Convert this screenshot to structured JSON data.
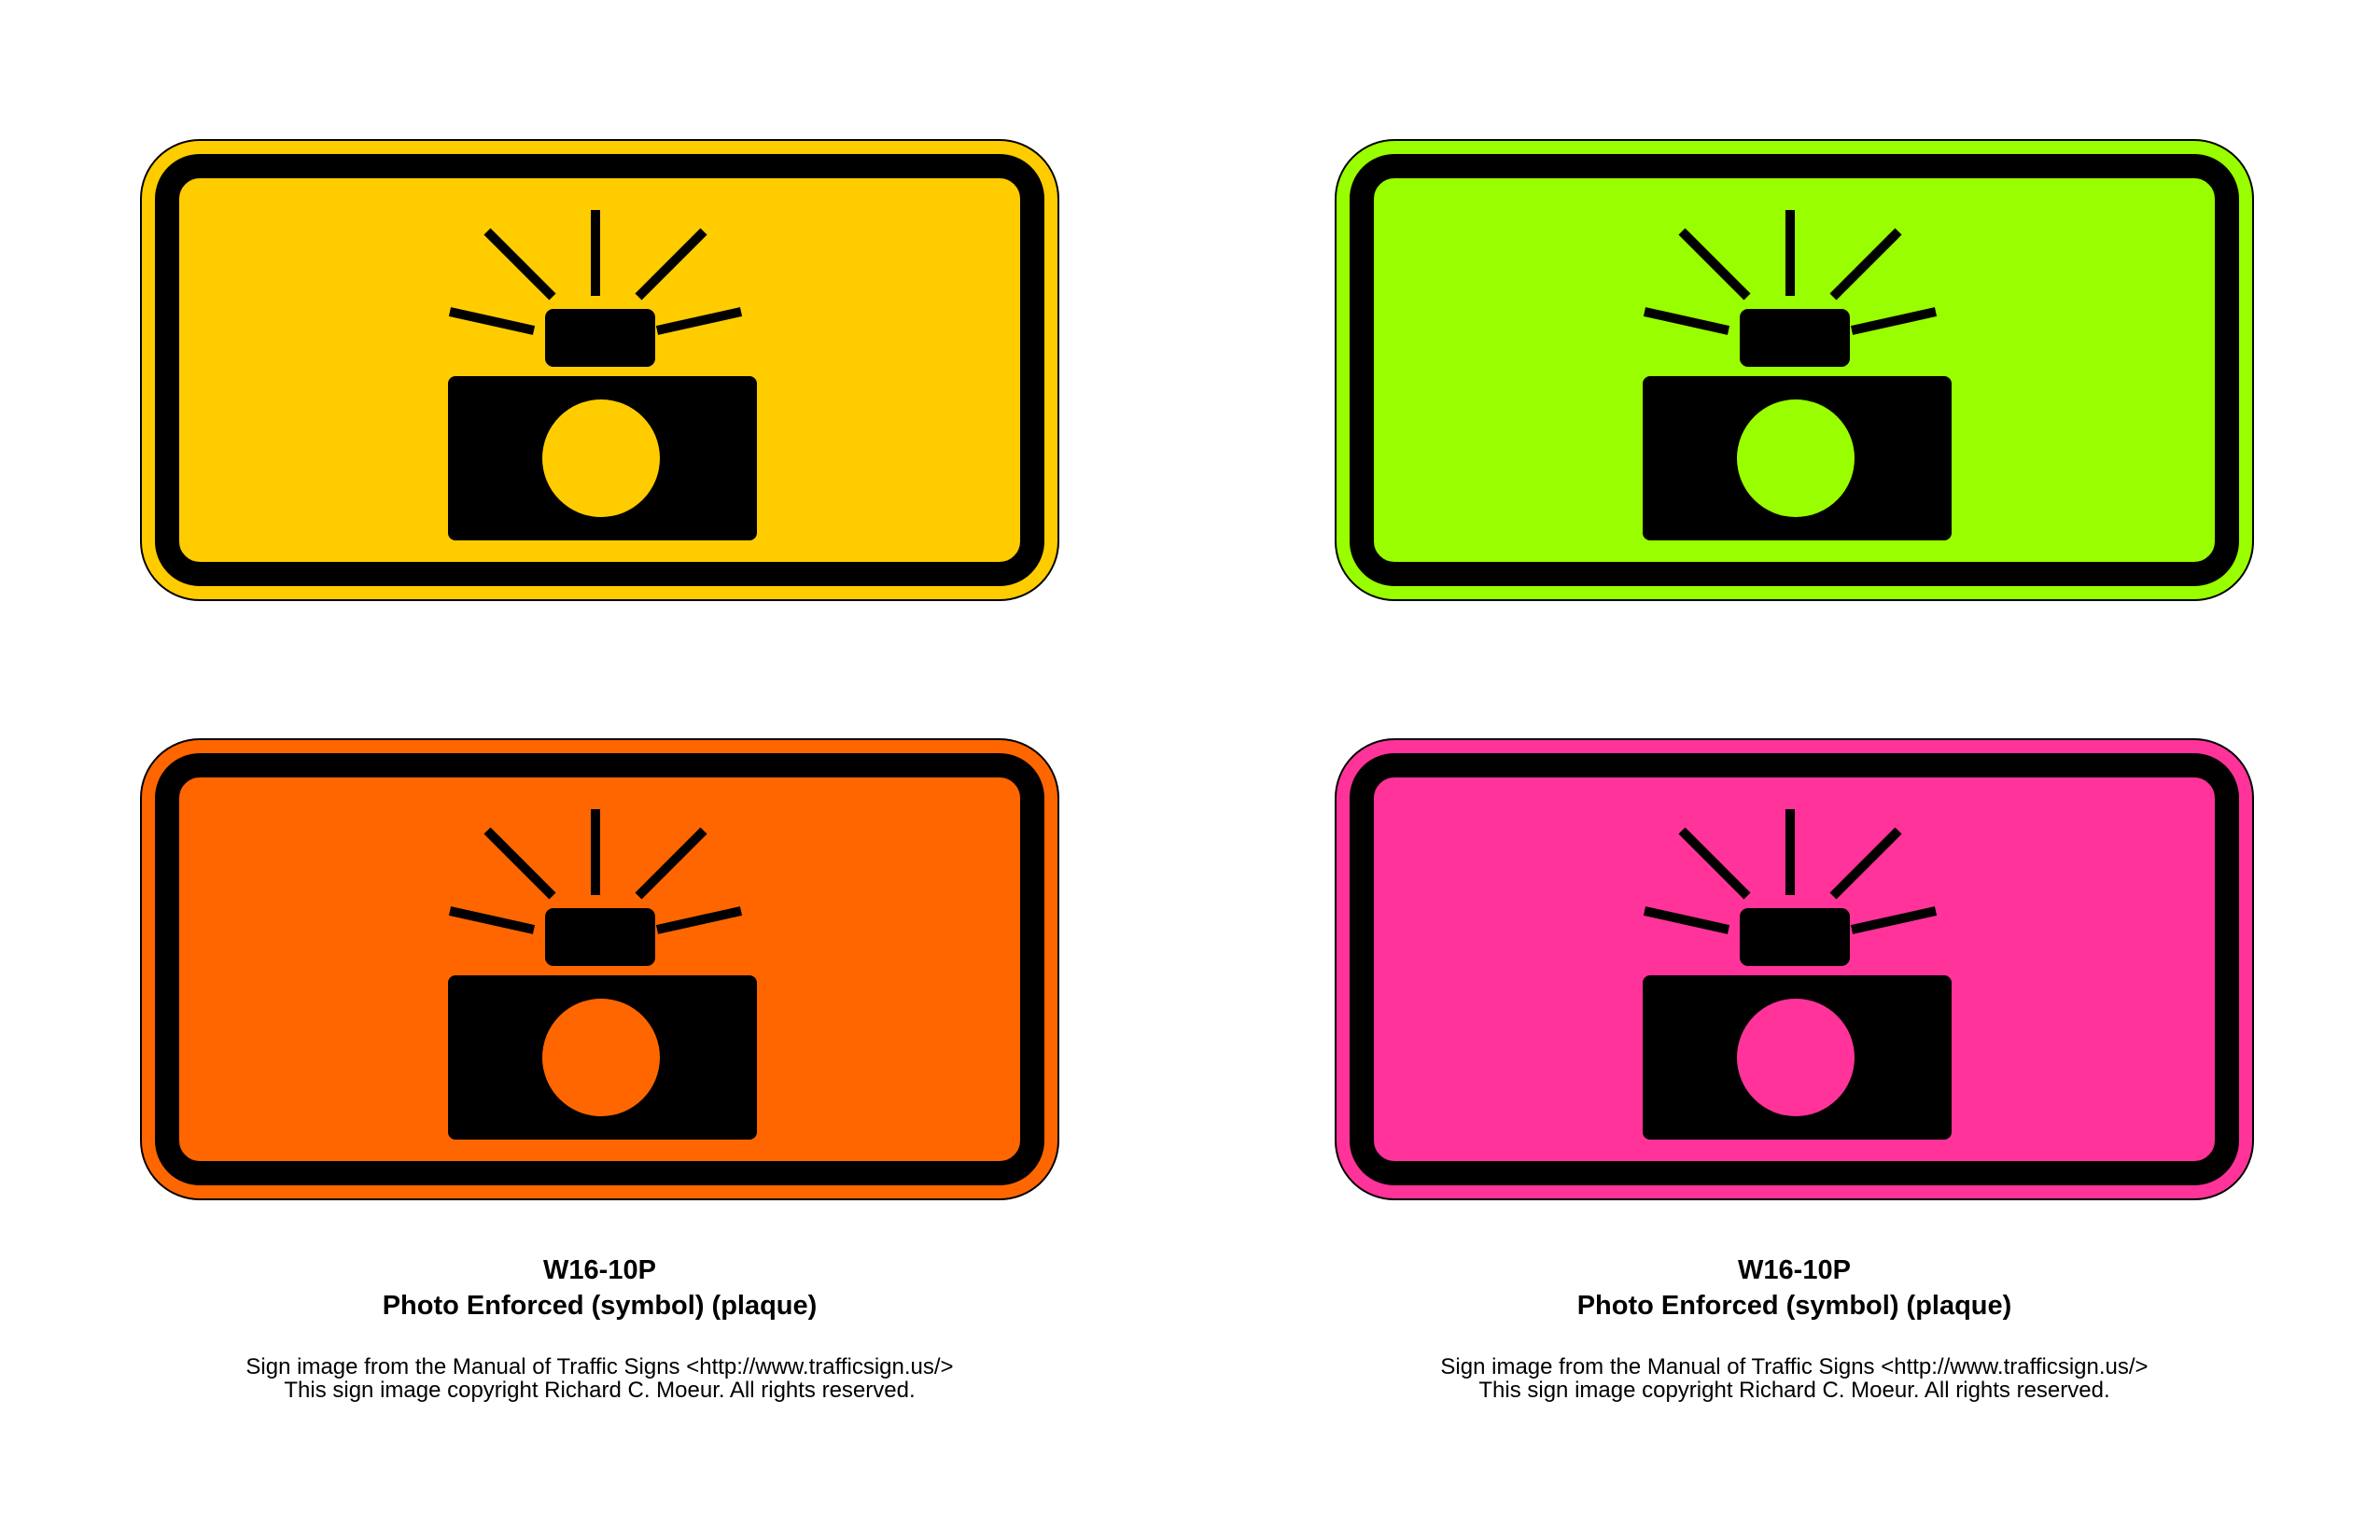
{
  "signs": [
    {
      "id": "yellow",
      "color": "#FFCC00",
      "icon": "camera-flash-icon"
    },
    {
      "id": "green",
      "color": "#99FF00",
      "icon": "camera-flash-icon"
    },
    {
      "id": "orange",
      "color": "#FF6600",
      "icon": "camera-flash-icon"
    },
    {
      "id": "pink",
      "color": "#FF3399",
      "icon": "camera-flash-icon"
    }
  ],
  "captions": [
    {
      "code": "W16-10P",
      "name": "Photo Enforced (symbol) (plaque)",
      "credit_line1": "Sign image from the Manual of Traffic Signs <http://www.trafficsign.us/>",
      "credit_line2": "This sign image copyright Richard C. Moeur. All rights reserved."
    },
    {
      "code": "W16-10P",
      "name": "Photo Enforced (symbol) (plaque)",
      "credit_line1": "Sign image from the Manual of Traffic Signs <http://www.trafficsign.us/>",
      "credit_line2": "This sign image copyright Richard C. Moeur. All rights reserved."
    }
  ]
}
